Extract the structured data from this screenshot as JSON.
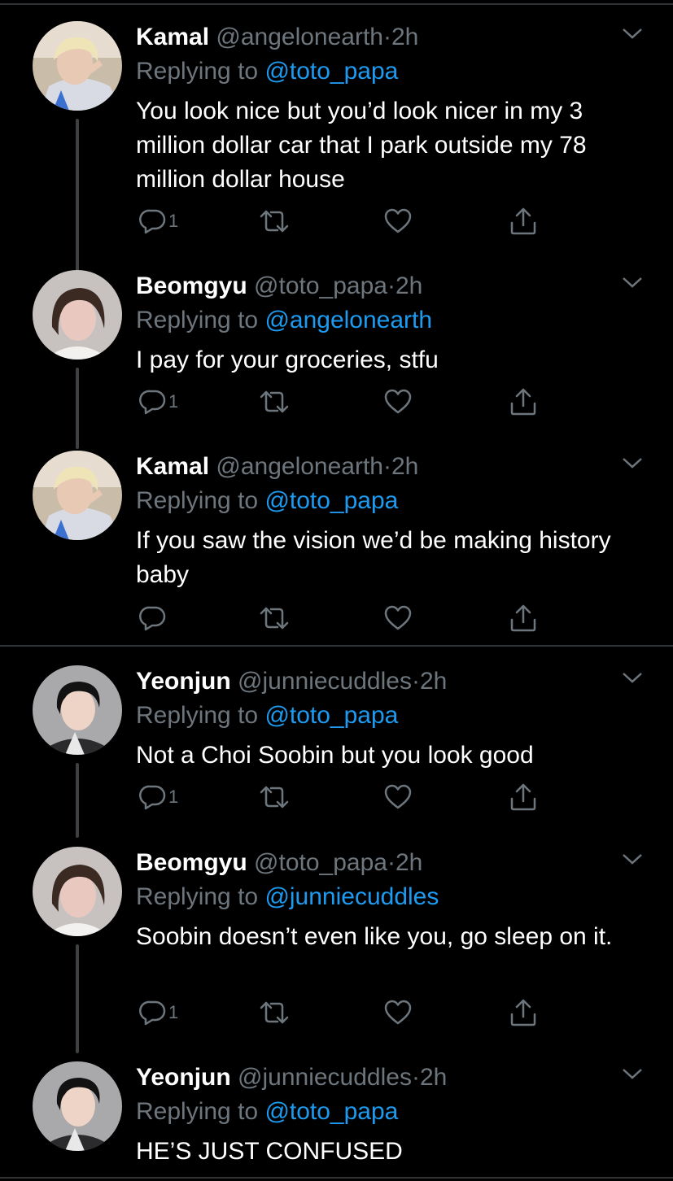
{
  "colors": {
    "background": "#000000",
    "text": "#ffffff",
    "muted": "#6e767d",
    "link": "#1d9bf0",
    "divider": "#2f3336",
    "thread_line": "#3d4144"
  },
  "reply_prefix": "Replying to",
  "separator": "·",
  "tweets": [
    {
      "name": "Kamal",
      "handle": "@angelonearth",
      "time": "2h",
      "reply_to": "@toto_papa",
      "text": "You look nice but you’d look nicer in my 3 million dollar car that I park outside my 78 million dollar house",
      "reply_count": "1",
      "avatar_icon": "blond-user-avatar"
    },
    {
      "name": "Beomgyu",
      "handle": "@toto_papa",
      "time": "2h",
      "reply_to": "@angelonearth",
      "text": "I pay for your groceries, stfu",
      "reply_count": "1",
      "avatar_icon": "dark-hair-user-avatar"
    },
    {
      "name": "Kamal",
      "handle": "@angelonearth",
      "time": "2h",
      "reply_to": "@toto_papa",
      "text": "If you saw the vision we’d be making history baby",
      "reply_count": "",
      "avatar_icon": "blond-user-avatar"
    },
    {
      "name": "Yeonjun",
      "handle": "@junniecuddles",
      "time": "2h",
      "reply_to": "@toto_papa",
      "text": "Not a Choi Soobin but you look good",
      "reply_count": "1",
      "avatar_icon": "black-hair-user-avatar"
    },
    {
      "name": "Beomgyu",
      "handle": "@toto_papa",
      "time": "2h",
      "reply_to": "@junniecuddles",
      "text": "Soobin doesn’t even like you, go sleep on it.",
      "reply_count": "1",
      "avatar_icon": "dark-hair-user-avatar"
    },
    {
      "name": "Yeonjun",
      "handle": "@junniecuddles",
      "time": "2h",
      "reply_to": "@toto_papa",
      "text": "HE’S JUST CONFUSED",
      "reply_count": "",
      "avatar_icon": "black-hair-user-avatar"
    }
  ],
  "action_icons": [
    "reply-icon",
    "retweet-icon",
    "like-icon",
    "share-icon"
  ]
}
